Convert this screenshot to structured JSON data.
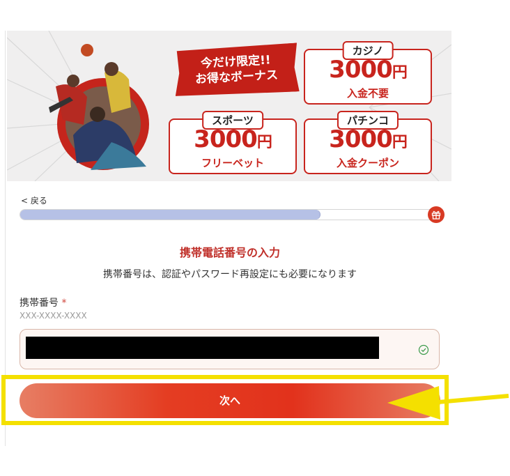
{
  "banner": {
    "promo_line1": "今だけ限定!!",
    "promo_line2": "お得なボーナス",
    "casino": {
      "tab": "カジノ",
      "amount": "3000",
      "unit": "円",
      "sub": "入金不要"
    },
    "sports": {
      "tab": "スポーツ",
      "amount": "3000",
      "unit": "円",
      "sub": "フリーベット"
    },
    "pachinko": {
      "tab": "パチンコ",
      "amount": "3000",
      "unit": "円",
      "sub": "入金クーポン"
    }
  },
  "nav": {
    "back_label": "< 戻る"
  },
  "progress": {
    "fraction": 0.72
  },
  "form": {
    "title": "携帯電話番号の入力",
    "description": "携帯番号は、認証やパスワード再設定にも必要になります",
    "phone_label": "携帯番号",
    "required_mark": "*",
    "phone_hint": "XXX-XXXX-XXXX"
  },
  "actions": {
    "next_label": "次へ"
  },
  "colors": {
    "brand_red": "#c8241d",
    "highlight_yellow": "#f4e000",
    "progress_blue": "#b6c1e6"
  },
  "icons": {
    "gift": "gift-icon",
    "valid": "check-circle-icon",
    "pointer": "arrow-left-icon"
  }
}
